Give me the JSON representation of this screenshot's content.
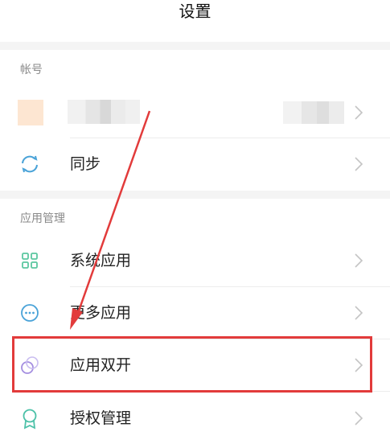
{
  "header": {
    "title": "设置"
  },
  "sections": {
    "account": {
      "label": "帐号"
    },
    "app_management": {
      "label": "应用管理"
    }
  },
  "rows": {
    "sync": {
      "label": "同步",
      "icon": "sync-icon"
    },
    "system_apps": {
      "label": "系统应用",
      "icon": "grid-icon"
    },
    "more_apps": {
      "label": "更多应用",
      "icon": "more-dots-icon"
    },
    "dual_apps": {
      "label": "应用双开",
      "icon": "dual-circles-icon"
    },
    "permissions": {
      "label": "授权管理",
      "icon": "badge-icon"
    }
  },
  "colors": {
    "accent_blue": "#4aa3d8",
    "grid_green": "#5cc7a0",
    "dual_purple": "#a48ee0",
    "badge_teal": "#4cc1a8",
    "annotation_red": "#e23b3b"
  }
}
